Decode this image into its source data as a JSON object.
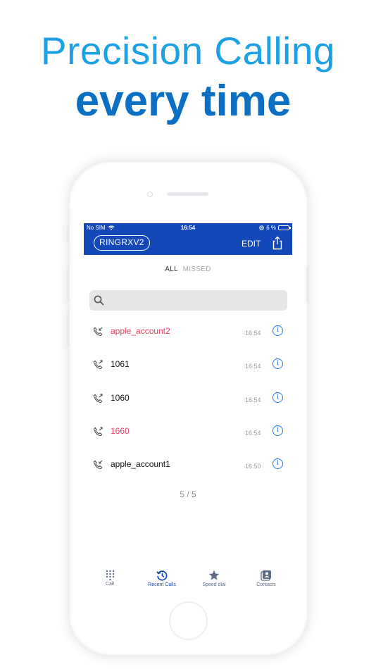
{
  "promo": {
    "line1": "Precision Calling",
    "line2": "every time"
  },
  "status_bar": {
    "carrier": "No SIM",
    "time": "16:54",
    "battery": "6 %"
  },
  "header": {
    "brand": "RINGRXV2",
    "edit_label": "EDIT"
  },
  "filter": {
    "all_label": "ALL",
    "missed_label": "MISSED"
  },
  "search": {
    "placeholder": ""
  },
  "calls": [
    {
      "name": "apple_account2",
      "time": "16:54",
      "missed": true,
      "icon": "incoming-call-icon"
    },
    {
      "name": "1061",
      "time": "16:54",
      "missed": false,
      "icon": "outgoing-call-icon"
    },
    {
      "name": "1060",
      "time": "16:54",
      "missed": false,
      "icon": "outgoing-call-icon"
    },
    {
      "name": "1660",
      "time": "16:54",
      "missed": true,
      "icon": "outgoing-call-icon"
    },
    {
      "name": "apple_account1",
      "time": "16:50",
      "missed": false,
      "icon": "incoming-call-icon"
    }
  ],
  "page_count": "5 / 5",
  "tabs": [
    {
      "label": "Call",
      "icon": "keypad-icon"
    },
    {
      "label": "Recent Calls",
      "icon": "history-icon"
    },
    {
      "label": "Speed dial",
      "icon": "star-icon"
    },
    {
      "label": "Contacts",
      "icon": "contacts-icon"
    }
  ],
  "colors": {
    "nav": "#1448b9",
    "missed": "#e5405e",
    "info": "#2a7ae2",
    "headline_light": "#1da1e6",
    "headline_dark": "#0b6fc4"
  }
}
